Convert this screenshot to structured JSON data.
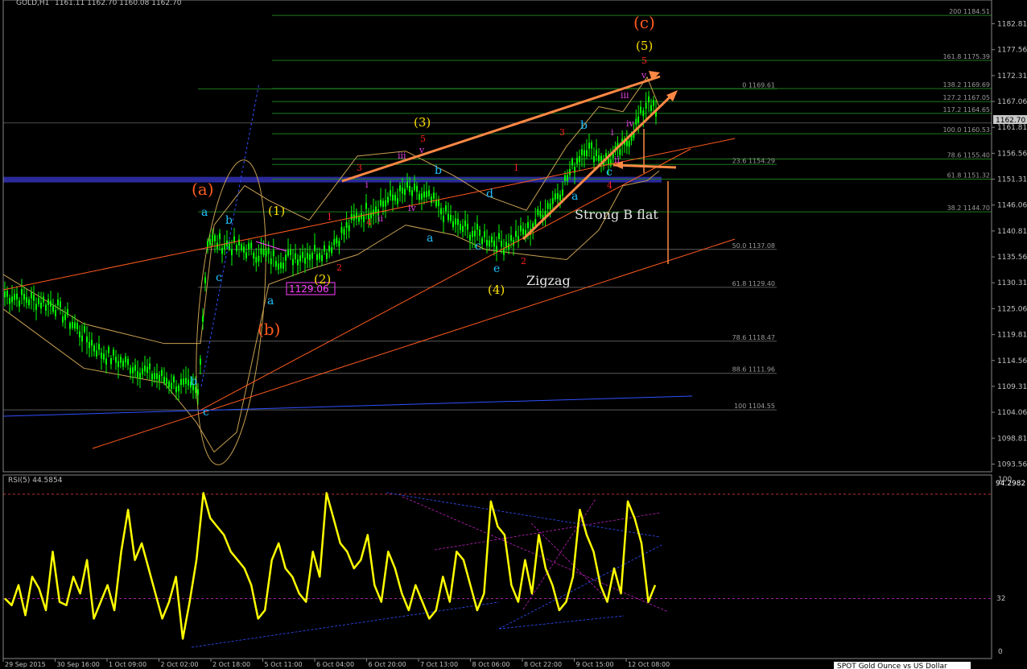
{
  "header": {
    "symbol": "GOLD,H1",
    "ohlc": "1161.11 1162.70 1160.08 1162.70"
  },
  "rsi_header": {
    "label": "RSI(5) 44.5854"
  },
  "rsi_levels": {
    "upper": "94.2982",
    "top": "100",
    "mid": "32",
    "bottom": "0"
  },
  "price_marker": {
    "value": "1162.70"
  },
  "footer_tab": {
    "label": "SPOT Gold Ounce vs US Dollar"
  },
  "colors": {
    "background": "#000000",
    "candles": "#00ff00",
    "bands": "#c8a050",
    "fib_lines": "#1e7a1e",
    "orange_lines": "#ff5a1e",
    "resistance_band": "#2a2a9a",
    "rsi_line": "#ffff00",
    "wave_white": "#ffffff"
  },
  "chart_data": [
    {
      "type": "candlestick",
      "title": "GOLD,H1",
      "ylim": [
        1092.0,
        1186.0
      ],
      "y_ticks": [
        "1182.81",
        "1177.56",
        "1172.31",
        "1167.06",
        "1161.81",
        "1156.56",
        "1151.31",
        "1146.06",
        "1140.81",
        "1135.56",
        "1130.31",
        "1125.06",
        "1119.81",
        "1114.56",
        "1109.31",
        "1104.06",
        "1098.81",
        "1093.56"
      ],
      "x_ticks": [
        "29 Sep 2015",
        "30 Sep 16:00",
        "1 Oct 09:00",
        "2 Oct 02:00",
        "2 Oct 18:00",
        "5 Oct 11:00",
        "6 Oct 04:00",
        "6 Oct 20:00",
        "7 Oct 13:00",
        "8 Oct 06:00",
        "8 Oct 22:00",
        "9 Oct 15:00",
        "12 Oct 08:00"
      ],
      "series": [
        {
          "name": "GOLD,H1",
          "path_points": [
            [
              0,
              1128
            ],
            [
              60,
              1126
            ],
            [
              120,
              1116
            ],
            [
              240,
              1108
            ],
            [
              252,
              1139
            ],
            [
              300,
              1137
            ],
            [
              340,
              1135
            ],
            [
              400,
              1137
            ],
            [
              440,
              1144
            ],
            [
              500,
              1149
            ],
            [
              530,
              1147
            ],
            [
              560,
              1142
            ],
            [
              620,
              1138
            ],
            [
              650,
              1141
            ],
            [
              690,
              1149
            ],
            [
              720,
              1158
            ],
            [
              750,
              1155
            ],
            [
              770,
              1158
            ],
            [
              790,
              1164
            ],
            [
              800,
              1168
            ],
            [
              812,
              1163
            ]
          ]
        }
      ],
      "fib_levels": [
        {
          "label": "200",
          "value": "1184.51"
        },
        {
          "label": "161.8",
          "value": "1175.39"
        },
        {
          "label": "0",
          "value": "1169.61"
        },
        {
          "label": "138.2",
          "value": "1169.69"
        },
        {
          "label": "127.2",
          "value": "1167.05"
        },
        {
          "label": "117.2",
          "value": "1164.65"
        },
        {
          "label": "100.0",
          "value": "1160.53"
        },
        {
          "label": "78.6",
          "value": "1155.40"
        },
        {
          "label": "23.6",
          "value": "1154.29"
        },
        {
          "label": "61.8",
          "value": "1151.32"
        },
        {
          "label": "38.2",
          "value": "1144.70"
        },
        {
          "label": "50.0",
          "value": "1137.08"
        },
        {
          "label": "61.8",
          "value": "1129.40"
        },
        {
          "label": "78.6",
          "value": "1118.47"
        },
        {
          "label": "88.6",
          "value": "1111.96"
        },
        {
          "label": "100",
          "value": "1104.55"
        }
      ],
      "price_label": "1129.06",
      "annotations": {
        "wave_big": [
          "(a)",
          "(b)",
          "(c)"
        ],
        "wave_yellow": [
          "(1)",
          "(2)",
          "(3)",
          "(4)",
          "(5)"
        ],
        "wave_red": [
          "1",
          "2",
          "3",
          "4",
          "5",
          "1",
          "2",
          "3",
          "4",
          "5"
        ],
        "wave_cyan": [
          "a",
          "b",
          "c",
          "a",
          "b",
          "c",
          "a",
          "b",
          "c",
          "d",
          "e",
          "a",
          "b",
          "c"
        ],
        "wave_magenta": [
          "i",
          "ii",
          "iii",
          "iv",
          "v",
          "i",
          "ii",
          "iii",
          "iv",
          "v"
        ],
        "text": [
          "Strong B flat",
          "Zigzag"
        ]
      }
    },
    {
      "type": "line",
      "title": "RSI(5) 44.5854",
      "ylim": [
        0,
        100
      ],
      "series": [
        {
          "name": "RSI(5)",
          "values": [
            32,
            28,
            40,
            22,
            45,
            38,
            25,
            60,
            30,
            28,
            45,
            35,
            55,
            20,
            30,
            40,
            25,
            60,
            85,
            55,
            65,
            50,
            35,
            20,
            30,
            45,
            8,
            30,
            55,
            95,
            80,
            75,
            70,
            60,
            55,
            50,
            40,
            20,
            25,
            55,
            65,
            50,
            45,
            35,
            30,
            60,
            45,
            95,
            80,
            65,
            60,
            50,
            55,
            70,
            40,
            30,
            60,
            50,
            35,
            25,
            40,
            30,
            20,
            25,
            45,
            30,
            60,
            55,
            40,
            25,
            35,
            90,
            75,
            70,
            40,
            30,
            55,
            35,
            70,
            50,
            40,
            25,
            30,
            45,
            85,
            70,
            60,
            40,
            30,
            50,
            35,
            90,
            80,
            65,
            30,
            40
          ]
        }
      ]
    }
  ]
}
